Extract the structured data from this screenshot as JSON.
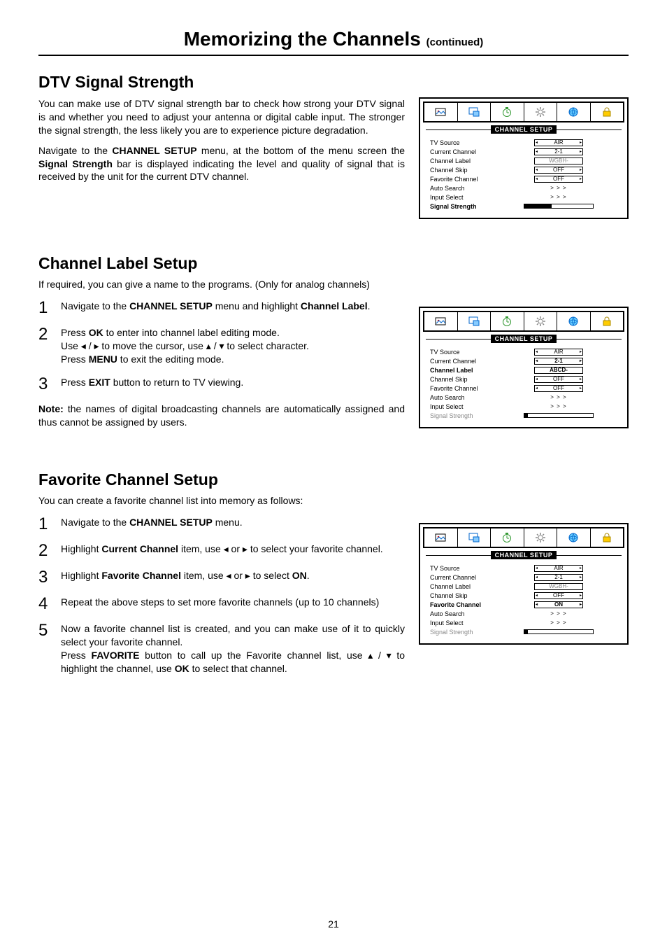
{
  "header": {
    "title": "Memorizing the Channels ",
    "continued": "(continued)"
  },
  "page_number": "21",
  "osd_header": "CHANNEL SETUP",
  "osd_link": "> > >",
  "icons": {
    "picture": "picture-icon",
    "pip": "pip-icon",
    "timer": "timer-icon",
    "setup": "setup-icon",
    "channel": "channel-icon",
    "lock": "lock-icon"
  },
  "section1": {
    "title": "DTV Signal Strength",
    "p1": "You can make use of DTV signal strength bar to check how strong your DTV signal is and whether you need to adjust your antenna or digital cable input. The stronger the signal strength, the less likely you are to experience picture degradation.",
    "p2_a": "Navigate to the ",
    "p2_b": "CHANNEL SETUP",
    "p2_c": " menu, at the bottom of the menu screen the ",
    "p2_d": "Signal Strength",
    "p2_e": " bar is displayed indicating the level and quality of signal that is received by the unit for the current DTV channel.",
    "osd": {
      "tv_source": "TV Source",
      "tv_source_val": "AIR",
      "current_channel": "Current Channel",
      "current_channel_val": "2-1",
      "channel_label": "Channel Label",
      "channel_label_val": "WGBH-",
      "channel_skip": "Channel Skip",
      "channel_skip_val": "OFF",
      "favorite_channel": "Favorite Channel",
      "favorite_channel_val": "OFF",
      "auto_search": "Auto Search",
      "input_select": "Input Select",
      "signal_strength": "Signal Strength"
    }
  },
  "section2": {
    "title": "Channel  Label  Setup",
    "intro": "If required, you can give a name to the programs. (Only for analog channels)",
    "step1_a": "Navigate to the ",
    "step1_b": "CHANNEL SETUP",
    "step1_c": " menu and highlight ",
    "step1_d": "Channel Label",
    "step1_e": ".",
    "step2_a": "Press ",
    "step2_b": "OK",
    "step2_c": "  to enter into channel label editing mode.",
    "step2_d": "Use ◂ / ▸ to move the cursor, use ▴ / ▾ to select character.",
    "step2_e": "Press ",
    "step2_f": "MENU",
    "step2_g": " to exit the editing mode.",
    "step3_a": "Press ",
    "step3_b": "EXIT",
    "step3_c": " button to return to TV viewing.",
    "note_a": "Note:",
    "note_b": " the names of digital broadcasting channels are automatically assigned and thus cannot be assigned by users.",
    "osd": {
      "tv_source": "TV Source",
      "tv_source_val": "AIR",
      "current_channel": "Current Channel",
      "current_channel_val": "2-1",
      "channel_label": "Channel Label",
      "channel_label_val": "ABCD-",
      "channel_skip": "Channel Skip",
      "channel_skip_val": "OFF",
      "favorite_channel": "Favorite Channel",
      "favorite_channel_val": "OFF",
      "auto_search": "Auto Search",
      "input_select": "Input Select",
      "signal_strength": "Signal Strength"
    }
  },
  "section3": {
    "title": "Favorite Channel  Setup",
    "intro": "You can create a favorite channel list into memory as follows:",
    "step1_a": "Navigate to the ",
    "step1_b": "CHANNEL SETUP",
    "step1_c": " menu.",
    "step2_a": "Highlight ",
    "step2_b": "Current Channel",
    "step2_c": " item, use ◂ or ▸ to select your favorite channel.",
    "step3_a": "Highlight ",
    "step3_b": "Favorite Channel",
    "step3_c": " item, use ◂ or ▸ to select ",
    "step3_d": "ON",
    "step3_e": ".",
    "step4": "Repeat the above steps to set more favorite channels (up to 10 channels)",
    "step5_a": "Now a favorite channel list is created, and you can make use of it to quickly select your favorite channel.",
    "step5_b": "Press ",
    "step5_c": "FAVORITE",
    "step5_d": " button to call up the Favorite channel list, use ▴ / ▾ to highlight the channel, use ",
    "step5_e": "OK",
    "step5_f": " to select that channel.",
    "osd": {
      "tv_source": "TV Source",
      "tv_source_val": "AIR",
      "current_channel": "Current Channel",
      "current_channel_val": "2-1",
      "channel_label": "Channel Label",
      "channel_label_val": "WGBH-",
      "channel_skip": "Channel Skip",
      "channel_skip_val": "OFF",
      "favorite_channel": "Favorite Channel",
      "favorite_channel_val": "ON",
      "auto_search": "Auto Search",
      "input_select": "Input Select",
      "signal_strength": "Signal Strength"
    }
  }
}
